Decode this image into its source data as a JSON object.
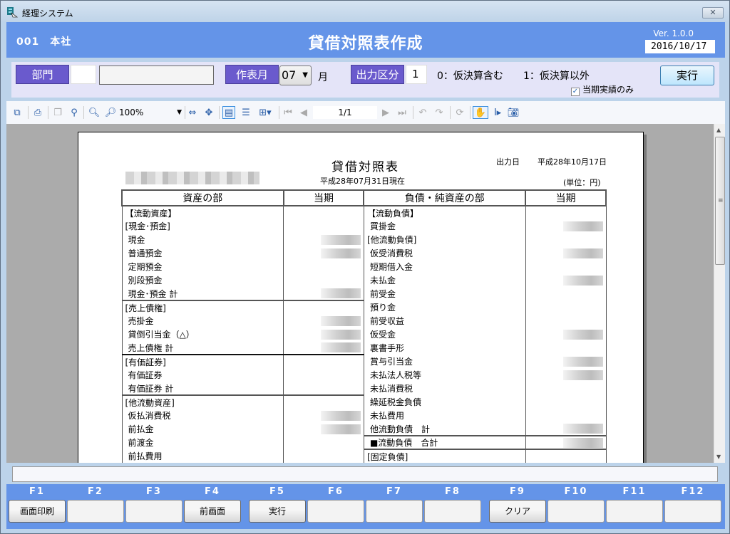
{
  "window": {
    "title": "経理システム",
    "close_label": "✕"
  },
  "header": {
    "company": "001　本社",
    "title": "貸借対照表作成",
    "version": "Ver. 1.0.0",
    "date": "2016/10/17"
  },
  "filters": {
    "dept_label": "部門",
    "dept_code": "",
    "dept_name": "",
    "month_label": "作表月",
    "month_value": "07",
    "month_unit": "月",
    "output_label": "出力区分",
    "output_value": "1",
    "output_hint0": "0：仮決算含む",
    "output_hint1": "1：仮決算以外",
    "execute_label": "実行",
    "checkbox_label": "当期実績のみ",
    "checkbox_checked": true
  },
  "toolbar": {
    "zoom_value": "100%",
    "page_indicator": "1/1",
    "icons": [
      "copy-icon",
      "print-icon",
      "copy-page-icon",
      "find-icon",
      "zoom-out-icon",
      "zoom-in-icon",
      "fit-width-icon",
      "fit-page-icon",
      "single-page-icon",
      "continuous-icon",
      "multi-page-icon",
      "first-page-icon",
      "prev-page-icon",
      "next-page-icon",
      "last-page-icon",
      "back-icon",
      "forward-icon",
      "refresh-icon",
      "hand-tool-icon",
      "text-select-icon",
      "snapshot-icon"
    ]
  },
  "report": {
    "title": "貸借対照表",
    "output_date_label": "出力日",
    "output_date": "平成28年10月17日",
    "as_of": "平成28年07月31日現在",
    "unit": "(単位：円)",
    "headers": {
      "assets": "資産の部",
      "assets_amount": "当期",
      "liabilities": "負債・純資産の部",
      "liabilities_amount": "当期"
    },
    "rows": [
      {
        "left": "【流動資産】",
        "li": false,
        "lv": false,
        "right": "【流動負債】",
        "ri": false,
        "rv": false
      },
      {
        "left": "[現金･預金]",
        "li": false,
        "lv": false,
        "right": "買掛金",
        "ri": true,
        "rv": true
      },
      {
        "left": "現金",
        "li": true,
        "lv": true,
        "right": "[他流動負債]",
        "ri": false,
        "rv": false
      },
      {
        "left": "普通預金",
        "li": true,
        "lv": true,
        "right": "仮受消費税",
        "ri": true,
        "rv": true
      },
      {
        "left": "定期預金",
        "li": true,
        "lv": false,
        "right": "短期借入金",
        "ri": true,
        "rv": false
      },
      {
        "left": "別段預金",
        "li": true,
        "lv": false,
        "right": "未払金",
        "ri": true,
        "rv": true
      },
      {
        "left": "現金･預金 計",
        "li": true,
        "lv": true,
        "right": "前受金",
        "ri": true,
        "rv": false
      },
      {
        "left": "[売上債権]",
        "li": false,
        "lv": false,
        "right": "預り金",
        "ri": true,
        "rv": false,
        "lsec": true
      },
      {
        "left": "売掛金",
        "li": true,
        "lv": true,
        "right": "前受収益",
        "ri": true,
        "rv": false
      },
      {
        "left": "貸倒引当金（△）",
        "li": true,
        "lv": true,
        "right": "仮受金",
        "ri": true,
        "rv": true
      },
      {
        "left": "売上債権 計",
        "li": true,
        "lv": true,
        "right": "裏書手形",
        "ri": true,
        "rv": false
      },
      {
        "left": "[有価証券]",
        "li": false,
        "lv": false,
        "right": "賞与引当金",
        "ri": true,
        "rv": true,
        "lsec": true
      },
      {
        "left": "有価証券",
        "li": true,
        "lv": false,
        "right": "未払法人税等",
        "ri": true,
        "rv": true
      },
      {
        "left": "有価証券 計",
        "li": true,
        "lv": false,
        "right": "未払消費税",
        "ri": true,
        "rv": false
      },
      {
        "left": "[他流動資産]",
        "li": false,
        "lv": false,
        "right": "繰延税金負債",
        "ri": true,
        "rv": false,
        "lsec": true
      },
      {
        "left": "仮払消費税",
        "li": true,
        "lv": true,
        "right": "未払費用",
        "ri": true,
        "rv": false
      },
      {
        "left": "前払金",
        "li": true,
        "lv": true,
        "right": "他流動負債　計",
        "ri": true,
        "rv": true
      },
      {
        "left": "前渡金",
        "li": true,
        "lv": false,
        "right": "■流動負債　合計",
        "ri": true,
        "rv": true,
        "rsec": true
      },
      {
        "left": "前払費用",
        "li": true,
        "lv": false,
        "right": "[固定負債]",
        "ri": false,
        "rv": false,
        "rsec": true
      }
    ]
  },
  "status_text": "",
  "fkeys": [
    {
      "key": "F1",
      "label": "画面印刷"
    },
    {
      "key": "F2",
      "label": ""
    },
    {
      "key": "F3",
      "label": ""
    },
    {
      "key": "F4",
      "label": "前画面"
    },
    {
      "key": "F5",
      "label": "実行"
    },
    {
      "key": "F6",
      "label": ""
    },
    {
      "key": "F7",
      "label": ""
    },
    {
      "key": "F8",
      "label": ""
    },
    {
      "key": "F9",
      "label": "クリア"
    },
    {
      "key": "F10",
      "label": ""
    },
    {
      "key": "F11",
      "label": ""
    },
    {
      "key": "F12",
      "label": ""
    }
  ]
}
